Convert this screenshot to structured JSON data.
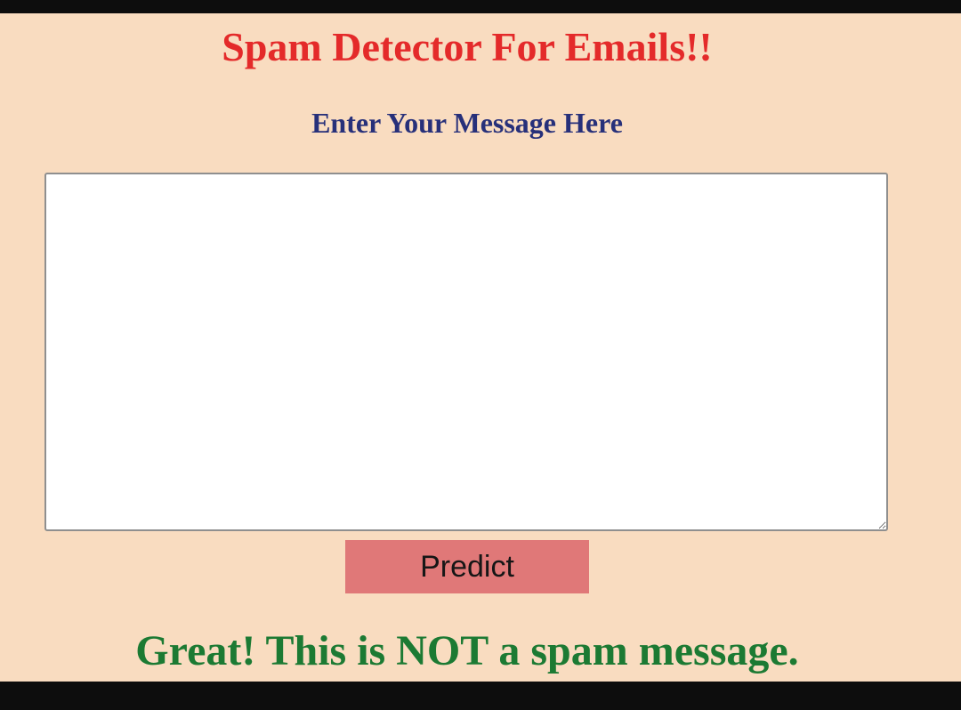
{
  "page": {
    "title": "Spam Detector For Emails!!",
    "subtitle": "Enter Your Message Here"
  },
  "form": {
    "message_value": "",
    "message_placeholder": "",
    "predict_label": "Predict"
  },
  "result": {
    "text": "Great! This is NOT a spam message."
  },
  "colors": {
    "background": "#f9dcc0",
    "title": "#e42a2a",
    "subtitle": "#27307a",
    "button": "#e07878",
    "result": "#1c7a33"
  }
}
